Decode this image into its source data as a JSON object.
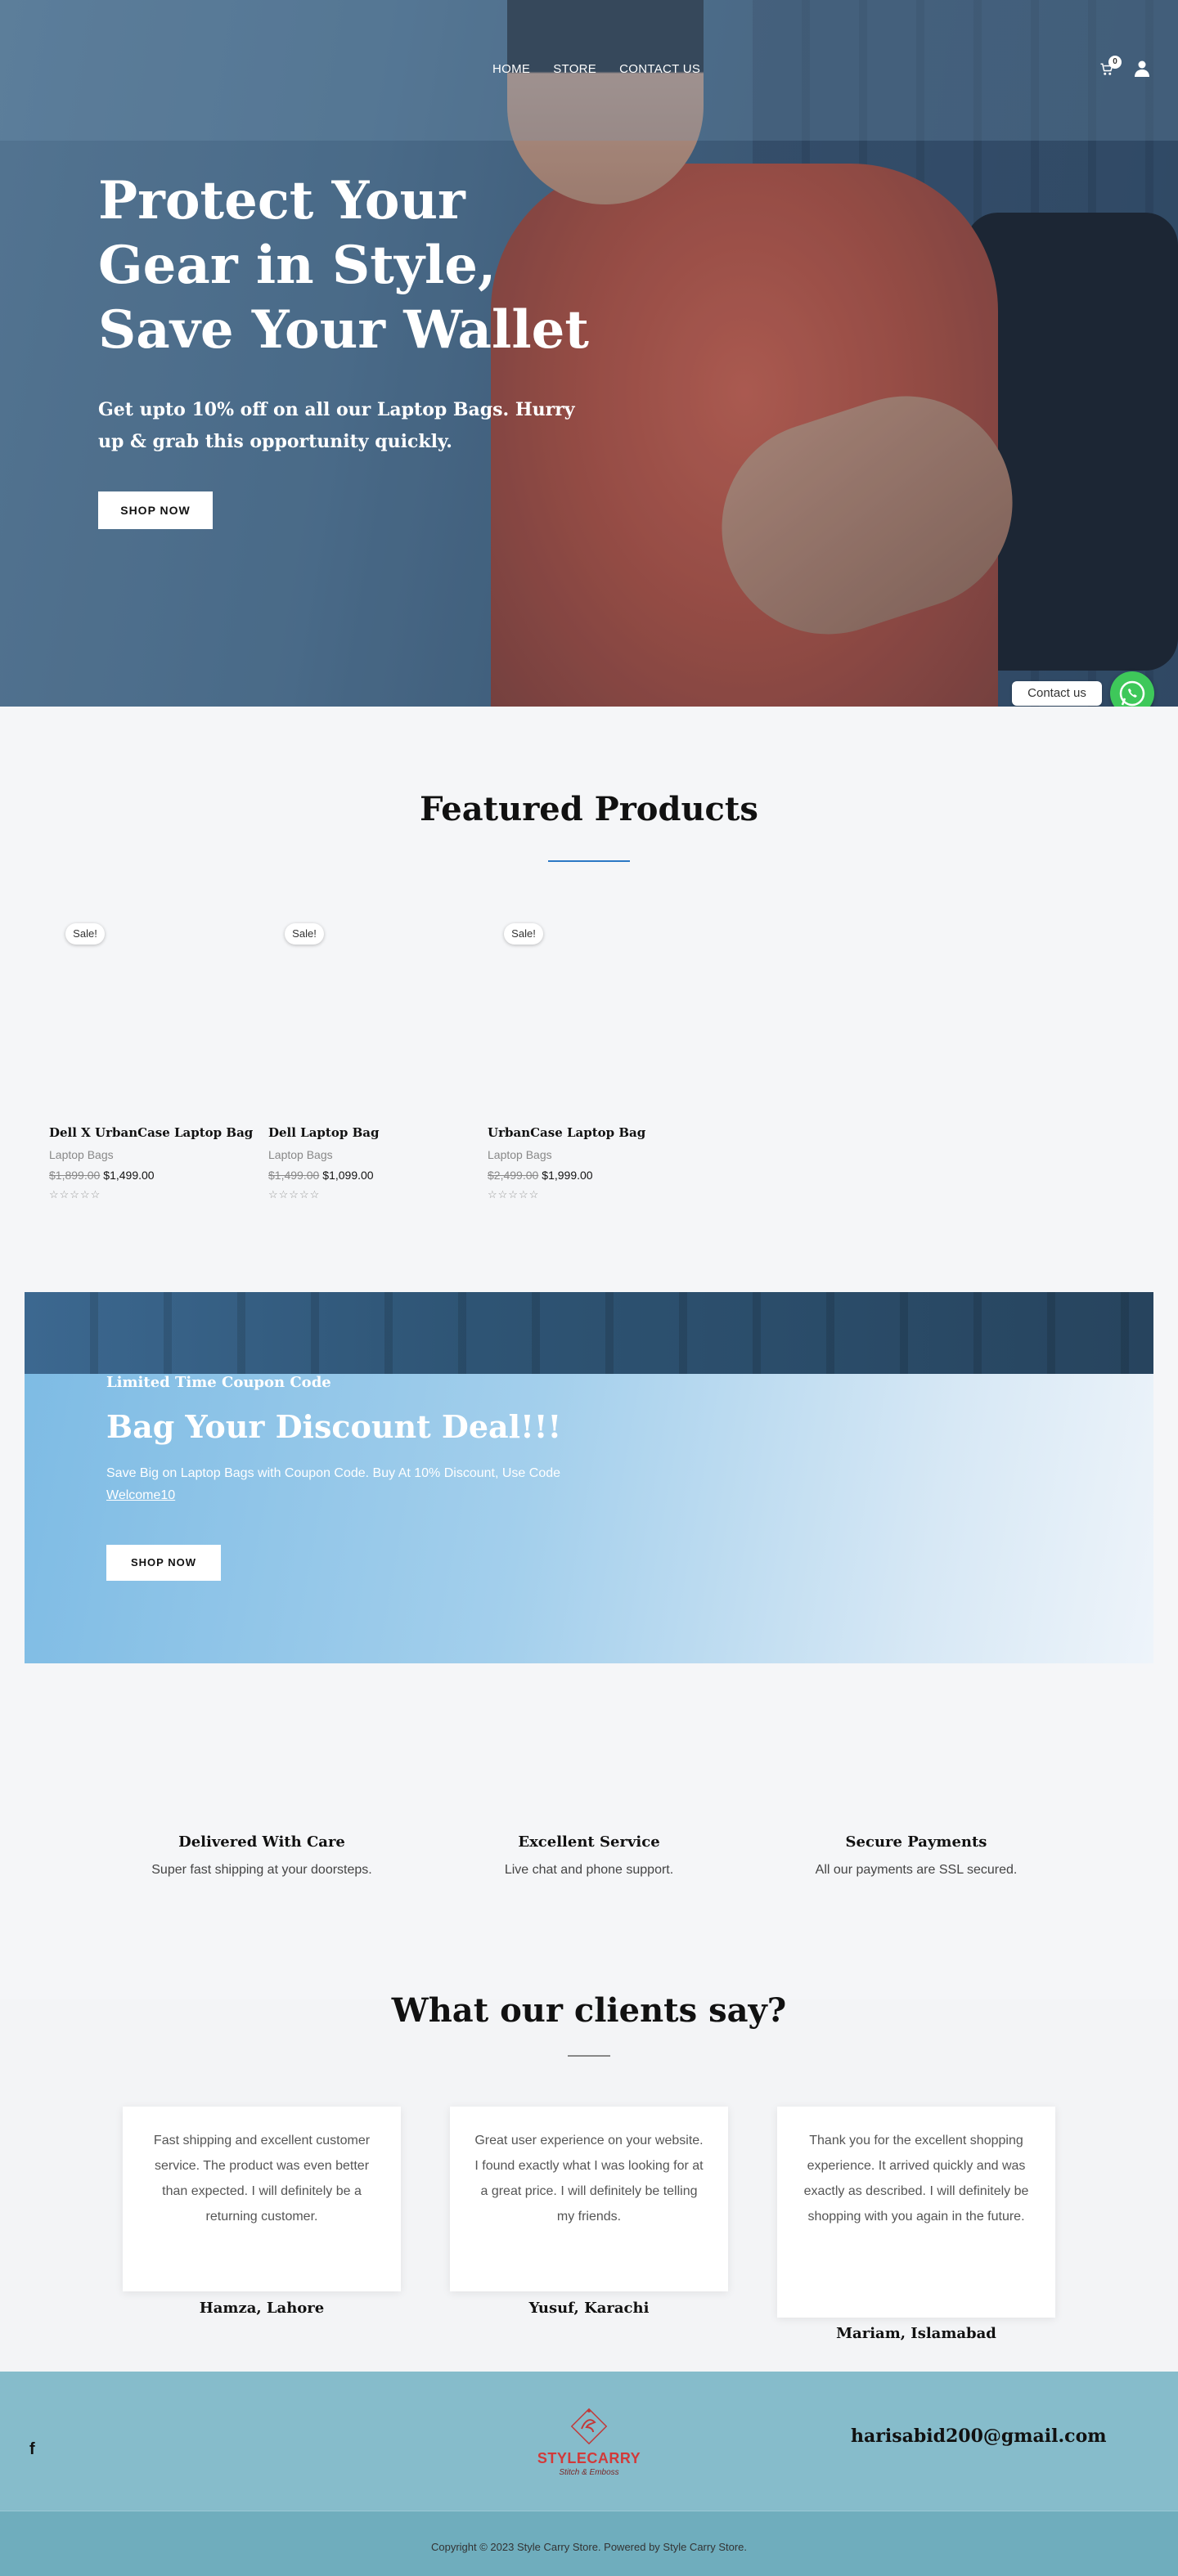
{
  "nav": {
    "links": [
      "HOME",
      "STORE",
      "CONTACT US"
    ],
    "cart_count": "0"
  },
  "hero": {
    "title": "Protect Your Gear in Style, Save Your Wallet",
    "subtitle": "Get upto 10% off on all our Laptop Bags. Hurry up & grab this opportunity quickly.",
    "button": "SHOP NOW"
  },
  "whatsapp": {
    "label": "Contact us"
  },
  "featured": {
    "title": "Featured Products",
    "products": [
      {
        "badge": "Sale!",
        "name": "Dell X UrbanCase Laptop Bag",
        "category": "Laptop Bags",
        "old_price": "$1,899.00",
        "price": "$1,499.00",
        "stars": "☆☆☆☆☆"
      },
      {
        "badge": "Sale!",
        "name": "Dell Laptop Bag",
        "category": "Laptop Bags",
        "old_price": "$1,499.00",
        "price": "$1,099.00",
        "stars": "☆☆☆☆☆"
      },
      {
        "badge": "Sale!",
        "name": "UrbanCase Laptop Bag",
        "category": "Laptop Bags",
        "old_price": "$2,499.00",
        "price": "$1,999.00",
        "stars": "☆☆☆☆☆"
      }
    ]
  },
  "coupon": {
    "eyebrow": "Limited Time Coupon Code",
    "title": "Bag Your Discount Deal!!!",
    "text": "Save Big on Laptop Bags with Coupon Code. Buy At 10% Discount, Use Code",
    "code": "Welcome10",
    "button": "SHOP NOW"
  },
  "features": [
    {
      "title": "Delivered With Care",
      "text": "Super fast shipping at your doorsteps."
    },
    {
      "title": "Excellent Service",
      "text": "Live chat and phone support."
    },
    {
      "title": "Secure Payments",
      "text": "All our payments are SSL secured."
    }
  ],
  "testimonials": {
    "title": "What our clients say?",
    "items": [
      {
        "quote": "Fast shipping and excellent customer service. The product was even better than expected. I will definitely be a returning customer.",
        "name": "Hamza, Lahore"
      },
      {
        "quote": "Great user experience on your website. I found exactly what I was looking for at a great price. I will definitely be telling my friends.",
        "name": "Yusuf, Karachi"
      },
      {
        "quote": "Thank you for the excellent shopping experience. It arrived quickly and was exactly as described. I will definitely be shopping with you again in the future.",
        "name": "Mariam, Islamabad"
      }
    ]
  },
  "footer": {
    "social_icon": "f",
    "logo_text": "STYLECARRY",
    "logo_tagline": "Stitch & Emboss",
    "email": "harisabid200@gmail.com",
    "copyright": "Copyright © 2023 Style Carry Store. Powered by Style Carry Store."
  }
}
